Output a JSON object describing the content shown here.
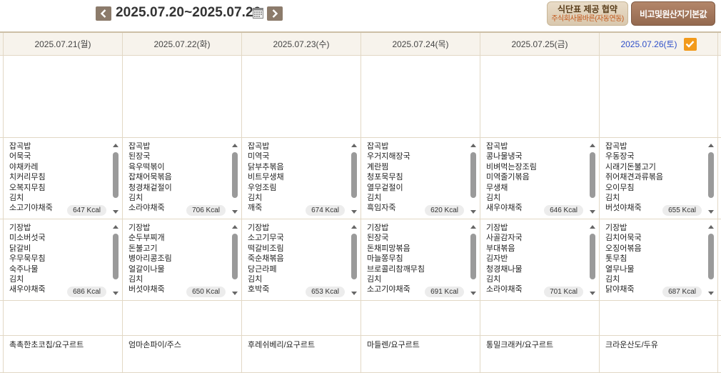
{
  "header": {
    "date_range": "2025.07.20~2025.07.26",
    "menu_button_line1": "식단표 제공 협약",
    "menu_button_line2": "주식회사몰바른(자동연동)",
    "etc_button": "비고및원산지기본값"
  },
  "colors": {
    "sat": "#2f4fc9",
    "check": "#f29a1b",
    "nav": "#8c7b6b",
    "brown_button": "#a27a5e"
  },
  "days": [
    {
      "date": "2025.07.21(월)",
      "lunch": [
        "잡곡밥",
        "어묵국",
        "야채카레",
        "치커리무침",
        "오복지무침",
        "김치",
        "소고기야채죽"
      ],
      "lunch_kcal": "647 Kcal",
      "dinner": [
        "기장밥",
        "미소버섯국",
        "닭갈비",
        "우무묵무침",
        "숙주나물",
        "김치",
        "새우야채죽"
      ],
      "dinner_kcal": "686 Kcal",
      "snack": "촉촉한초코칩/요구르트"
    },
    {
      "date": "2025.07.22(화)",
      "lunch": [
        "잡곡밥",
        "된장국",
        "육우떡볶이",
        "잡채어묵볶음",
        "청경채겉절이",
        "김치",
        "소라야채죽"
      ],
      "lunch_kcal": "706 Kcal",
      "dinner": [
        "기장밥",
        "순두부찌개",
        "돈불고기",
        "병아리콩조림",
        "얼갈이나물",
        "김치",
        "버섯야채죽"
      ],
      "dinner_kcal": "650 Kcal",
      "snack": "엄마손파이/주스"
    },
    {
      "date": "2025.07.23(수)",
      "lunch": [
        "잡곡밥",
        "미역국",
        "닭부추볶음",
        "비트무생채",
        "우엉조림",
        "김치",
        "깨죽"
      ],
      "lunch_kcal": "674 Kcal",
      "dinner": [
        "기장밥",
        "소고기무국",
        "떡갈비조림",
        "죽순채볶음",
        "당근라페",
        "김치",
        "호박죽"
      ],
      "dinner_kcal": "653 Kcal",
      "snack": "후레쉬베리/요구르트"
    },
    {
      "date": "2025.07.24(목)",
      "lunch": [
        "잡곡밥",
        "우거지해장국",
        "계란찜",
        "청포묵무침",
        "열무겉절이",
        "김치",
        "흑임자죽"
      ],
      "lunch_kcal": "620 Kcal",
      "dinner": [
        "기장밥",
        "된장국",
        "돈채피망볶음",
        "마늘쫑무침",
        "브로콜리참깨무침",
        "김치",
        "소고기야채죽"
      ],
      "dinner_kcal": "691 Kcal",
      "snack": "마들렌/요구르트"
    },
    {
      "date": "2025.07.25(금)",
      "lunch": [
        "잡곡밥",
        "콩나물냉국",
        "비벼먹는장조림",
        "미역줄기볶음",
        "무생채",
        "김치",
        "새우야채죽"
      ],
      "lunch_kcal": "646 Kcal",
      "dinner": [
        "기장밥",
        "사골감자국",
        "부대볶음",
        "김자반",
        "청경채나물",
        "김치",
        "소라야채죽"
      ],
      "dinner_kcal": "701 Kcal",
      "snack": "통밀크래커/요구르트"
    },
    {
      "date": "2025.07.26(토)",
      "lunch": [
        "잡곡밥",
        "우동장국",
        "시래기돈불고기",
        "쥐어채견과류볶음",
        "오이무침",
        "김치",
        "버섯야채죽"
      ],
      "lunch_kcal": "655 Kcal",
      "dinner": [
        "기장밥",
        "김치어묵국",
        "오징어볶음",
        "톳무침",
        "열무나물",
        "김치",
        "닭야채죽"
      ],
      "dinner_kcal": "687 Kcal",
      "snack": "크라운산도/두유"
    }
  ]
}
